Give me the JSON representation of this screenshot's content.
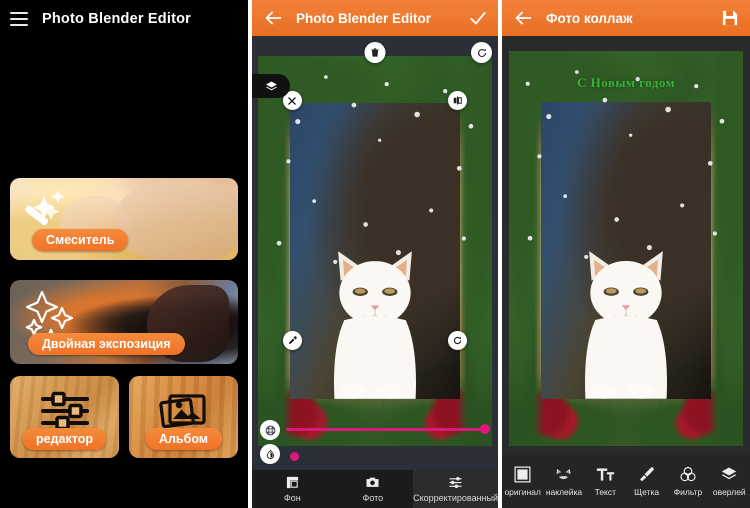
{
  "colors": {
    "appbar_orange": "#ea6f22",
    "pill_orange": "#ef7227",
    "slider_pink": "#e0157d",
    "greeting_green": "#37b13a",
    "panel_dark": "#1b1b1b"
  },
  "panel_home": {
    "menu_icon": "hamburger-icon",
    "title": "Photo Blender Editor",
    "cards": [
      {
        "label": "Смеситель",
        "icon": "magic-wand-sparkle-icon"
      },
      {
        "label": "Двойная экспозиция",
        "icon": "sparkles-icon"
      },
      {
        "label": "редактор",
        "icon": "sliders-icon"
      },
      {
        "label": "Альбом",
        "icon": "photo-stack-icon"
      }
    ]
  },
  "panel_editor": {
    "appbar": {
      "back_icon": "back-arrow-icon",
      "title": "Photo Blender Editor",
      "action_icon": "check-icon"
    },
    "canvas": {
      "layers_icon": "layers-icon",
      "delete_icon": "trash-icon",
      "rotate_icon": "rotate-icon",
      "close_icon": "close-icon",
      "flip_icon": "flip-horizontal-icon",
      "eyedropper_icon": "eyedropper-icon",
      "resize_icon": "resize-rotate-icon",
      "grid_icon": "grid-circle-icon",
      "opacity_icon": "opacity-drop-icon",
      "slider_value": "100"
    },
    "tabs": [
      {
        "label": "Фон",
        "icon": "background-square-icon",
        "selected": "false"
      },
      {
        "label": "Фото",
        "icon": "camera-icon",
        "selected": "false"
      },
      {
        "label": "Скорректированный",
        "icon": "adjust-sliders-icon",
        "selected": "true"
      }
    ]
  },
  "panel_collage": {
    "appbar": {
      "back_icon": "back-arrow-icon",
      "title": "Фото коллаж",
      "action_icon": "save-floppy-icon"
    },
    "canvas": {
      "greeting_text": "С Новым годом"
    },
    "toolbar": [
      {
        "label": "оригинал",
        "icon": "original-square-icon"
      },
      {
        "label": "наклейка",
        "icon": "sticker-cat-icon"
      },
      {
        "label": "Текст",
        "icon": "text-tt-icon"
      },
      {
        "label": "Щетка",
        "icon": "brush-icon"
      },
      {
        "label": "Фильтр",
        "icon": "filter-circles-icon"
      },
      {
        "label": "оверлей",
        "icon": "overlay-diamond-icon"
      }
    ]
  }
}
